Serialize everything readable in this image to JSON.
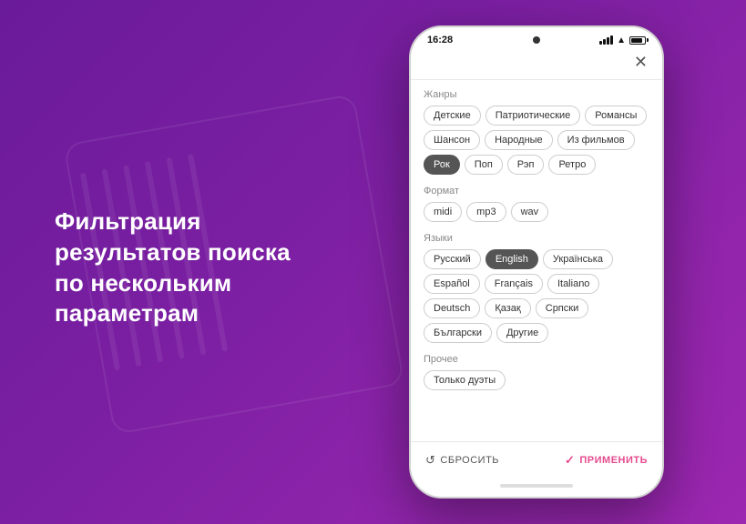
{
  "background": {
    "gradient_start": "#6a1b9a",
    "gradient_end": "#9c27b0"
  },
  "left_text": {
    "line1": "Фильтрация",
    "line2": "результатов поиска",
    "line3": "по нескольким",
    "line4": "параметрам"
  },
  "phone": {
    "status_bar": {
      "time": "16:28",
      "camera_dot": "●"
    },
    "close_button_label": "✕",
    "sections": [
      {
        "id": "genres",
        "label": "Жанры",
        "tags": [
          {
            "label": "Детские",
            "active": false
          },
          {
            "label": "Патриотические",
            "active": false
          },
          {
            "label": "Романсы",
            "active": false
          },
          {
            "label": "Шансон",
            "active": false
          },
          {
            "label": "Народные",
            "active": false
          },
          {
            "label": "Из фильмов",
            "active": false
          },
          {
            "label": "Рок",
            "active": true
          },
          {
            "label": "Поп",
            "active": false
          },
          {
            "label": "Рэп",
            "active": false
          },
          {
            "label": "Ретро",
            "active": false
          }
        ]
      },
      {
        "id": "format",
        "label": "Формат",
        "tags": [
          {
            "label": "midi",
            "active": false
          },
          {
            "label": "mp3",
            "active": false
          },
          {
            "label": "wav",
            "active": false
          }
        ]
      },
      {
        "id": "languages",
        "label": "Языки",
        "tags": [
          {
            "label": "Русский",
            "active": false
          },
          {
            "label": "English",
            "active": true
          },
          {
            "label": "Українська",
            "active": false
          },
          {
            "label": "Español",
            "active": false
          },
          {
            "label": "Français",
            "active": false
          },
          {
            "label": "Italiano",
            "active": false
          },
          {
            "label": "Deutsch",
            "active": false
          },
          {
            "label": "Қазақ",
            "active": false
          },
          {
            "label": "Српски",
            "active": false
          },
          {
            "label": "Български",
            "active": false
          },
          {
            "label": "Другие",
            "active": false
          }
        ]
      },
      {
        "id": "misc",
        "label": "Прочее",
        "tags": [
          {
            "label": "Только дуэты",
            "active": false
          }
        ]
      }
    ],
    "footer": {
      "reset_label": "СБРОСИТЬ",
      "apply_label": "ПРИМЕНИТЬ"
    }
  }
}
